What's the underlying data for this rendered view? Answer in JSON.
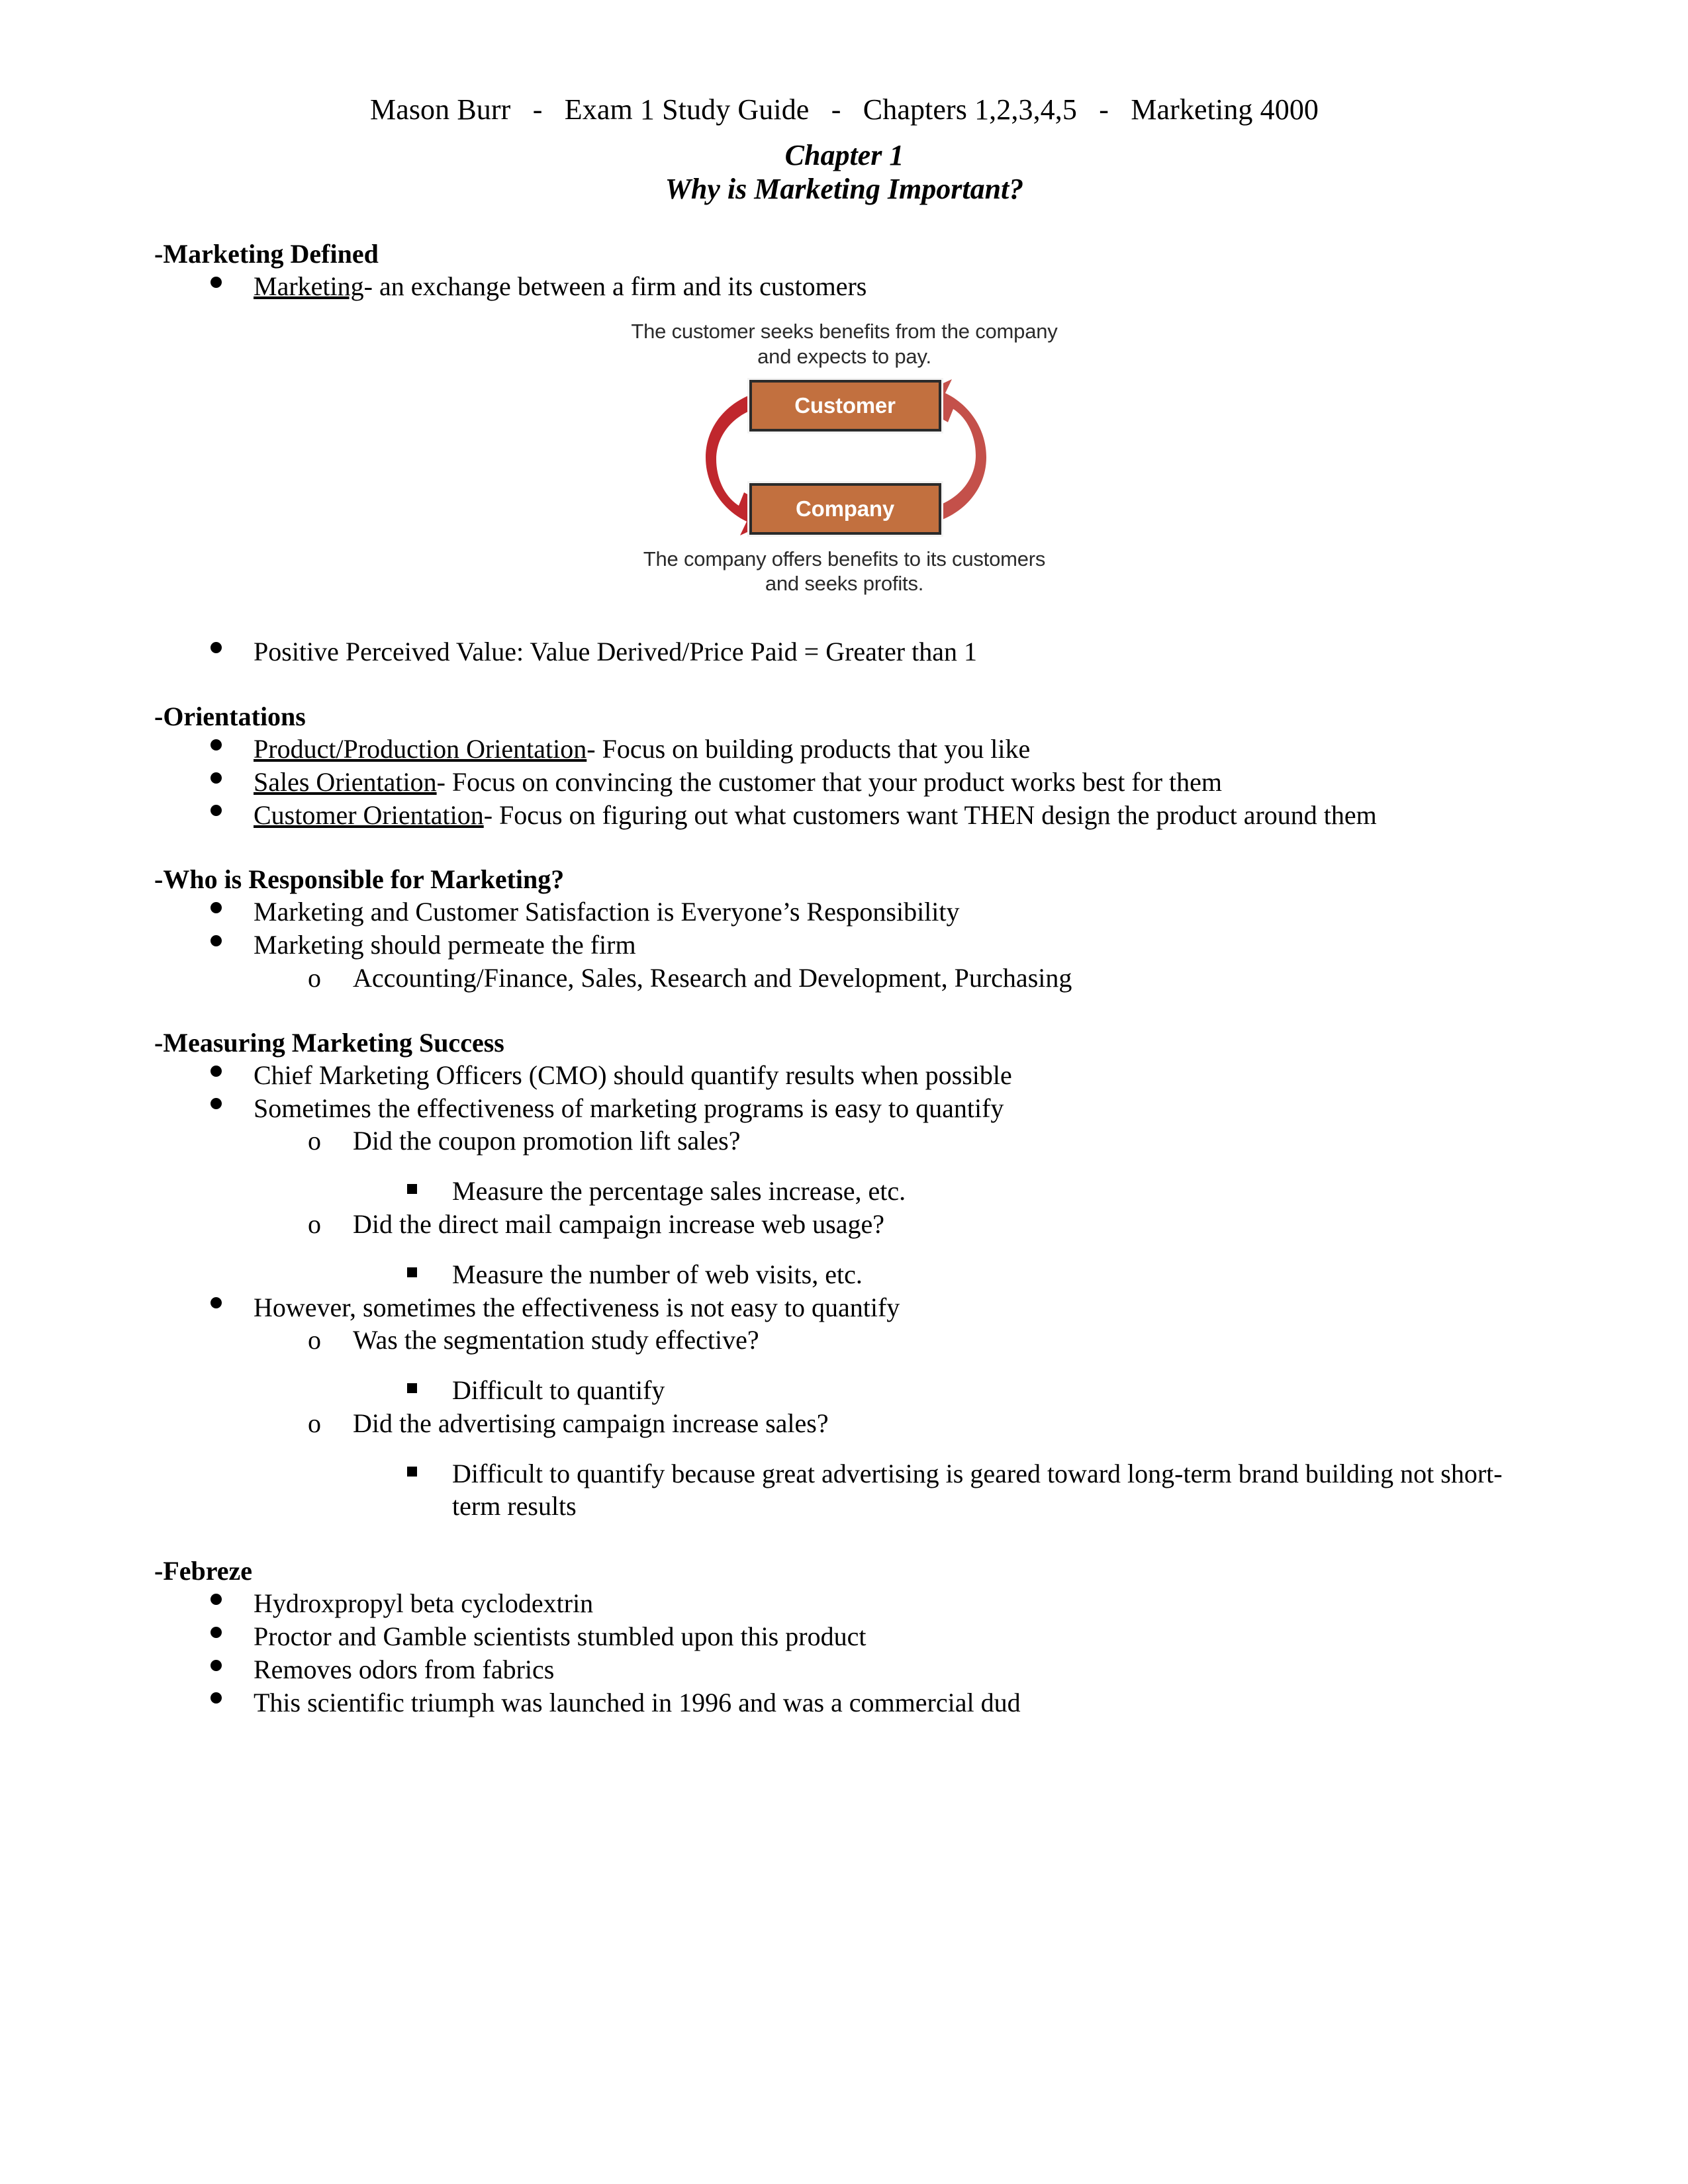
{
  "document": {
    "header_line": "Mason Burr   -   Exam 1 Study Guide   -   Chapters 1,2,3,4,5   -   Marketing 4000",
    "chapter_title": "Chapter 1",
    "chapter_subtitle": "Why is Marketing Important?"
  },
  "sections": {
    "marketing_defined": {
      "heading": "-Marketing Defined",
      "bullet_term": "Marketing",
      "bullet_rest": "- an exchange between a firm and its customers",
      "value_bullet": "Positive Perceived Value: Value Derived/Price Paid = Greater than 1"
    },
    "orientations": {
      "heading": "-Orientations",
      "items": [
        {
          "term": "Product/Production Orientation",
          "rest": "- Focus on building products that you like"
        },
        {
          "term": "Sales Orientation",
          "rest": "- Focus on convincing the customer that your product works best for them"
        },
        {
          "term": "Customer Orientation",
          "rest": "- Focus on figuring out what customers want THEN design the product around them"
        }
      ]
    },
    "responsibility": {
      "heading": "-Who is Responsible for Marketing?",
      "items": [
        "Marketing and Customer Satisfaction is Everyone’s Responsibility",
        "Marketing should permeate the firm"
      ],
      "sub_item": "Accounting/Finance, Sales, Research and Development, Purchasing"
    },
    "measuring": {
      "heading": "-Measuring Marketing Success",
      "b1": "Chief Marketing Officers (CMO) should quantify results when possible",
      "b2": "Sometimes the effectiveness of marketing programs is easy to quantify",
      "b2_q1": "Did the coupon promotion lift sales?",
      "b2_q1_a": "Measure the percentage sales increase, etc.",
      "b2_q2": "Did the direct mail campaign increase web usage?",
      "b2_q2_a": "Measure the number of web visits, etc.",
      "b3": "However, sometimes the effectiveness is not easy to quantify",
      "b3_q1": "Was the segmentation study effective?",
      "b3_q1_a": "Difficult to quantify",
      "b3_q2": "Did the advertising campaign increase sales?",
      "b3_q2_a": "Difficult to quantify because great advertising is geared toward long-term brand building not short-term results"
    },
    "febreze": {
      "heading": "-Febreze",
      "items": [
        "Hydroxpropyl beta cyclodextrin",
        " Proctor and Gamble scientists stumbled upon this product",
        "Removes odors from fabrics",
        "This scientific triumph was launched in 1996 and was a commercial dud"
      ]
    }
  },
  "figure": {
    "top_caption_line1": "The customer seeks benefits from the company",
    "top_caption_line2": "and expects to pay.",
    "node_top": "Customer",
    "node_bottom": "Company",
    "bottom_caption_line1": "The company offers benefits to its customers",
    "bottom_caption_line2": "and seeks profits.",
    "colors": {
      "node_fill": "#c2703f",
      "node_border": "#2b2b2b",
      "arrow_dark": "#c0272d",
      "arrow_light": "#c4504a",
      "node_text": "#ffffff"
    }
  }
}
